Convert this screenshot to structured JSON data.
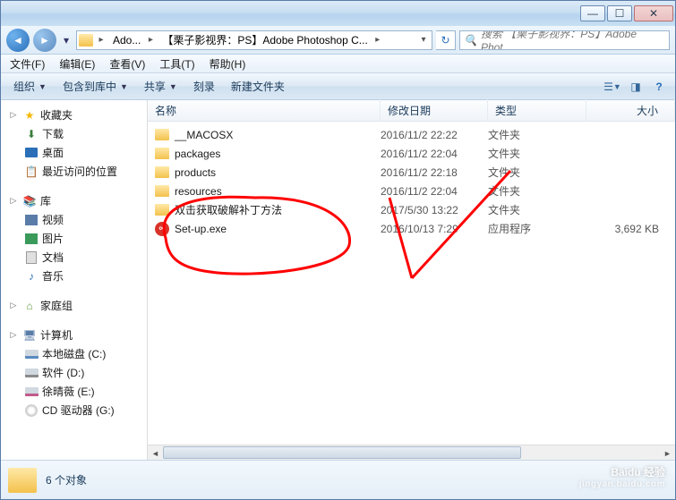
{
  "titlebar": {
    "min": "—",
    "max": "☐",
    "close": "✕"
  },
  "address": {
    "crumb1": "Ado...",
    "crumb2": "【栗子影视界：PS】Adobe Photoshop C...",
    "refresh": "↻"
  },
  "search": {
    "placeholder": "搜索 【栗子影视界：PS】Adobe Phot..."
  },
  "menu": {
    "file": "文件(F)",
    "edit": "编辑(E)",
    "view": "查看(V)",
    "tools": "工具(T)",
    "help": "帮助(H)"
  },
  "toolbar": {
    "organize": "组织",
    "include": "包含到库中",
    "share": "共享",
    "burn": "刻录",
    "newfolder": "新建文件夹"
  },
  "sidebar": {
    "favorites": "收藏夹",
    "downloads": "下载",
    "desktop": "桌面",
    "recent": "最近访问的位置",
    "library": "库",
    "video": "视频",
    "pictures": "图片",
    "documents": "文档",
    "music": "音乐",
    "homegroup": "家庭组",
    "computer": "计算机",
    "drive_c": "本地磁盘 (C:)",
    "drive_d": "软件 (D:)",
    "drive_e": "徐晴薇 (E:)",
    "drive_cd": "CD 驱动器 (G:)"
  },
  "columns": {
    "name": "名称",
    "date": "修改日期",
    "type": "类型",
    "size": "大小"
  },
  "rows": [
    {
      "name": "__MACOSX",
      "date": "2016/11/2 22:22",
      "type": "文件夹",
      "size": "",
      "icon": "folder"
    },
    {
      "name": "packages",
      "date": "2016/11/2 22:04",
      "type": "文件夹",
      "size": "",
      "icon": "folder"
    },
    {
      "name": "products",
      "date": "2016/11/2 22:18",
      "type": "文件夹",
      "size": "",
      "icon": "folder"
    },
    {
      "name": "resources",
      "date": "2016/11/2 22:04",
      "type": "文件夹",
      "size": "",
      "icon": "folder"
    },
    {
      "name": "双击获取破解补丁方法",
      "date": "2017/5/30 13:22",
      "type": "文件夹",
      "size": "",
      "icon": "folder"
    },
    {
      "name": "Set-up.exe",
      "date": "2016/10/13 7:29",
      "type": "应用程序",
      "size": "3,692 KB",
      "icon": "app"
    }
  ],
  "status": {
    "text": "6 个对象"
  },
  "watermark": {
    "main": "Baidu 经验",
    "sub": "jingyan.baidu.com"
  }
}
